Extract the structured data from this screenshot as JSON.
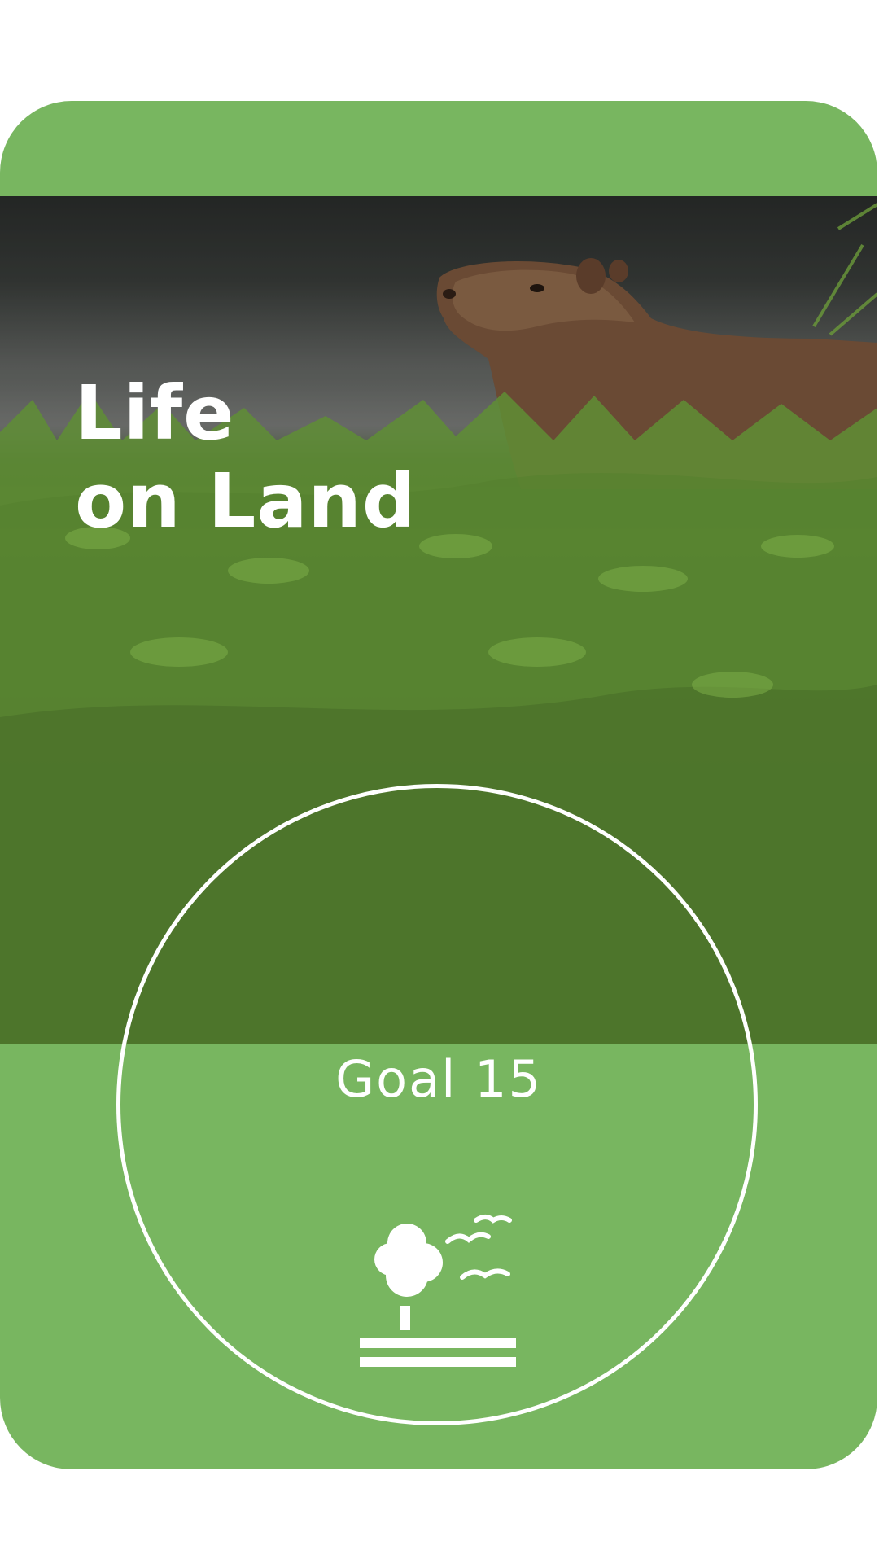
{
  "card": {
    "title_line1": "Life",
    "title_line2": "on Land",
    "goal_label": "Goal 15",
    "background_color": "#78b660",
    "icon": "tree-birds-icon",
    "photo": "capybara-in-grass-image"
  }
}
